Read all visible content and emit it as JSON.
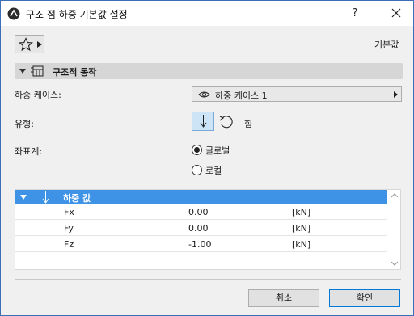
{
  "window": {
    "title": "구조 점 하중 기본값 설정",
    "help_label": "?"
  },
  "toolbar": {
    "default_label": "기본값"
  },
  "section": {
    "title": "구조적 동작"
  },
  "load_case": {
    "label": "하중 케이스:",
    "value": "하중 케이스 1"
  },
  "type": {
    "label": "유형:",
    "moment_label": "힘"
  },
  "coord": {
    "label": "좌표계:",
    "options": [
      {
        "label": "글로벌",
        "checked": true
      },
      {
        "label": "로컬",
        "checked": false
      }
    ]
  },
  "table": {
    "header": "하중 값",
    "rows": [
      {
        "name": "Fx",
        "value": "0.00",
        "unit": "[kN]"
      },
      {
        "name": "Fy",
        "value": "0.00",
        "unit": "[kN]"
      },
      {
        "name": "Fz",
        "value": "-1.00",
        "unit": "[kN]"
      }
    ]
  },
  "buttons": {
    "cancel": "취소",
    "ok": "확인"
  },
  "colors": {
    "accent": "#3f93e6",
    "window_border": "#3c6fb8",
    "selected_button": "#cde4f7"
  },
  "icons": {
    "app": "archicad-logo-icon",
    "favorites": "star-icon",
    "section": "structural-icon",
    "eye": "eye-icon",
    "force": "force-arrow-down-icon",
    "moment": "moment-rotate-icon",
    "close": "close-icon"
  }
}
